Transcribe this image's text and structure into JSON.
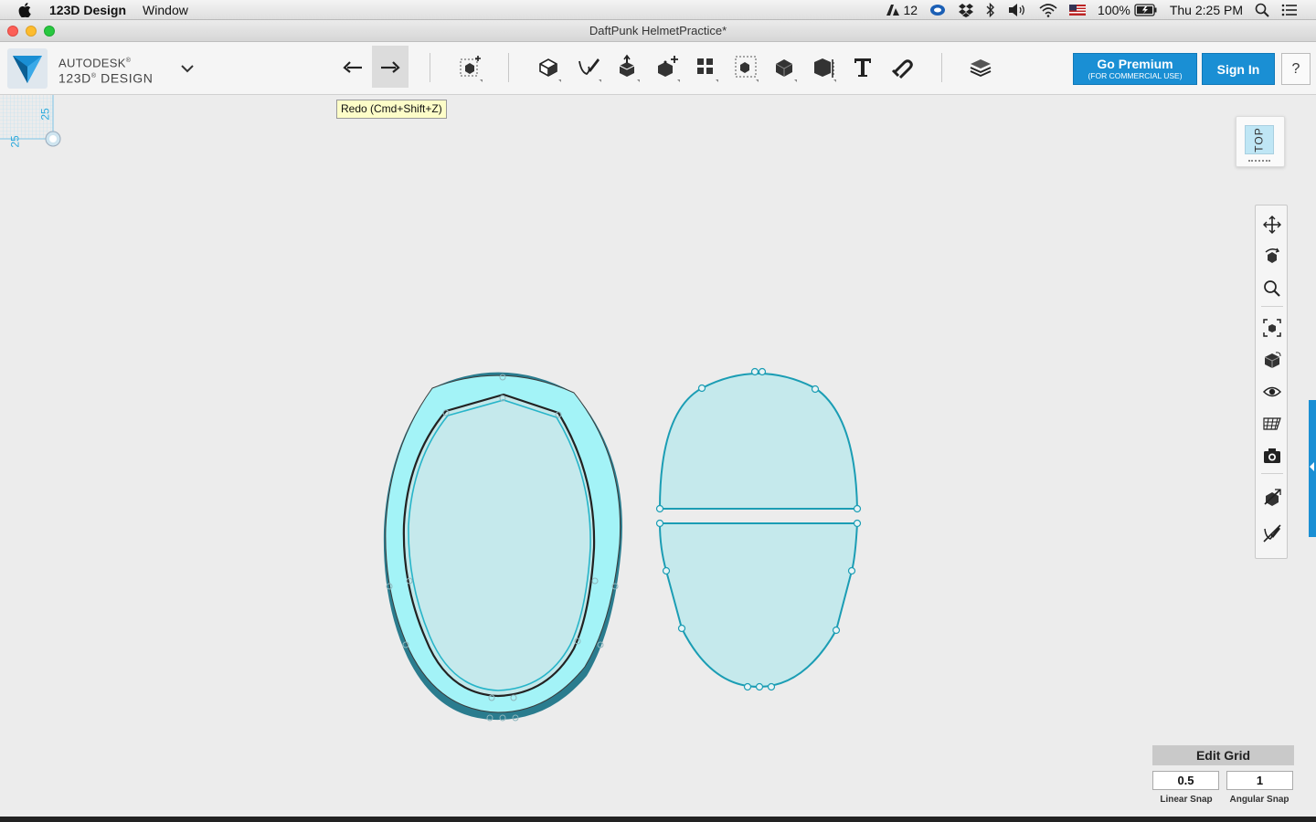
{
  "menubar": {
    "app_name": "123D Design",
    "menu_window": "Window",
    "adobe_badge": "12",
    "battery": "100%",
    "clock": "Thu 2:25 PM"
  },
  "window": {
    "title": "DaftPunk HelmetPractice*"
  },
  "brand": {
    "line1": "AUTODESK",
    "line1_mark": "®",
    "line2": "123D",
    "line2_mark": "®",
    "line2_rest": " DESIGN"
  },
  "toolbar": {
    "tools": [
      "undo",
      "redo",
      "primitives",
      "sketch",
      "construct",
      "modify",
      "pattern",
      "grouping",
      "combine",
      "measure",
      "text",
      "snap",
      "material"
    ]
  },
  "tooltip": {
    "text": "Redo (Cmd+Shift+Z)"
  },
  "premium": {
    "title": "Go Premium",
    "subtitle": "(FOR COMMERCIAL USE)"
  },
  "signin": {
    "label": "Sign In"
  },
  "help": {
    "label": "?"
  },
  "grid_thumb": {
    "label_x": "25",
    "label_y": "25"
  },
  "viewcube": {
    "face_label": "TOP"
  },
  "edit_grid": {
    "title": "Edit Grid",
    "linear_value": "0.5",
    "angular_value": "1",
    "linear_label": "Linear Snap",
    "angular_label": "Angular Snap"
  },
  "colors": {
    "accent": "#1a8fd4",
    "sketch_fill": "#c5e9ec",
    "sketch_stroke": "#1b9db4",
    "solid_fill": "#9eeff5"
  }
}
